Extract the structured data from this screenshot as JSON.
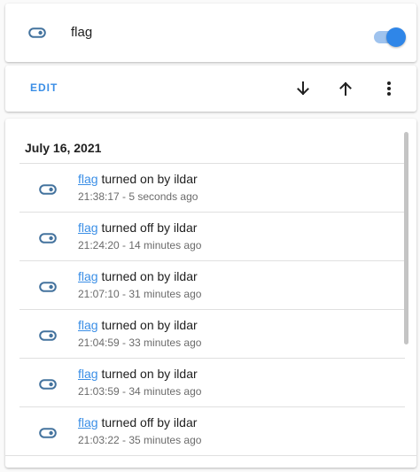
{
  "entity": {
    "name": "flag",
    "icon": "toggle-switch-outline-icon",
    "state_on": true,
    "accent_color": "#2f86e8"
  },
  "actions": {
    "edit_label": "EDIT",
    "move_down_icon": "arrow-down-icon",
    "move_up_icon": "arrow-up-icon",
    "more_icon": "dots-vertical-icon"
  },
  "logbook": {
    "date": "July 16, 2021",
    "entries": [
      {
        "entity": "flag",
        "text": " turned on by ildar",
        "time": "21:38:17 - 5 seconds ago"
      },
      {
        "entity": "flag",
        "text": " turned off by ildar",
        "time": "21:24:20 - 14 minutes ago"
      },
      {
        "entity": "flag",
        "text": " turned on by ildar",
        "time": "21:07:10 - 31 minutes ago"
      },
      {
        "entity": "flag",
        "text": " turned on by ildar",
        "time": "21:04:59 - 33 minutes ago"
      },
      {
        "entity": "flag",
        "text": " turned on by ildar",
        "time": "21:03:59 - 34 minutes ago"
      },
      {
        "entity": "flag",
        "text": " turned off by ildar",
        "time": "21:03:22 - 35 minutes ago"
      }
    ]
  }
}
